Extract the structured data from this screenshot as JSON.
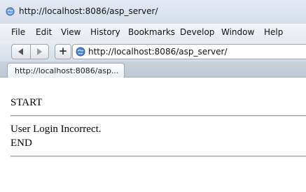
{
  "window": {
    "title": "http://localhost:8086/asp_server/"
  },
  "menu": [
    "File",
    "Edit",
    "View",
    "History",
    "Bookmarks",
    "Develop",
    "Window",
    "Help"
  ],
  "toolbar": {
    "back_icon": "back-arrow-icon",
    "forward_icon": "forward-arrow-icon",
    "add_label": "+",
    "address_value": "http://localhost:8086/asp_server/"
  },
  "tabs": [
    {
      "label": "http://localhost:8086/asp..."
    }
  ],
  "page": {
    "start": "START",
    "message": "User Login Incorrect.",
    "end": "END"
  }
}
